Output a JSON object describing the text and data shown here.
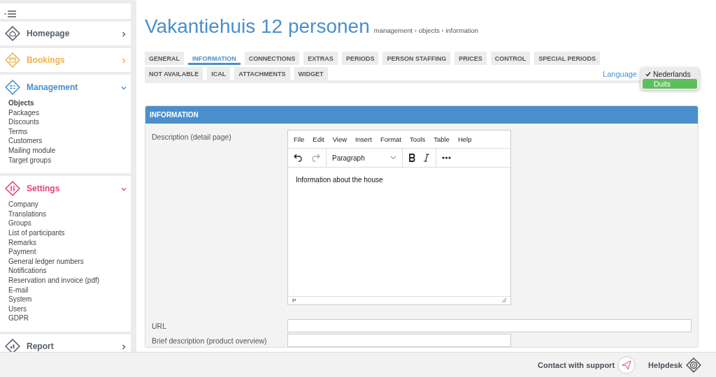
{
  "sidebar": {
    "sections": [
      {
        "kind": "home",
        "title": "Homepage",
        "color": "#555e6b",
        "expanded": false
      },
      {
        "kind": "bookings",
        "title": "Bookings",
        "color": "#f0b24a",
        "expanded": false
      },
      {
        "kind": "management",
        "title": "Management",
        "color": "#4a8fcb",
        "expanded": true,
        "items": [
          {
            "label": "Objects",
            "selected": true
          },
          {
            "label": "Packages",
            "selected": false
          },
          {
            "label": "Discounts",
            "selected": false
          },
          {
            "label": "Terms",
            "selected": false
          },
          {
            "label": "Customers",
            "selected": false
          },
          {
            "label": "Mailing module",
            "selected": false
          },
          {
            "label": "Target groups",
            "selected": false
          }
        ]
      },
      {
        "kind": "settings",
        "title": "Settings",
        "color": "#e0457b",
        "expanded": true,
        "items": [
          {
            "label": "Company",
            "selected": false
          },
          {
            "label": "Translations",
            "selected": false
          },
          {
            "label": "Groups",
            "selected": false
          },
          {
            "label": "List of participants",
            "selected": false
          },
          {
            "label": "Remarks",
            "selected": false
          },
          {
            "label": "Payment",
            "selected": false
          },
          {
            "label": "General ledger numbers",
            "selected": false
          },
          {
            "label": "Notifications",
            "selected": false
          },
          {
            "label": "Reservation and invoice (pdf)",
            "selected": false
          },
          {
            "label": "E-mail",
            "selected": false
          },
          {
            "label": "System",
            "selected": false
          },
          {
            "label": "Users",
            "selected": false
          },
          {
            "label": "GDPR",
            "selected": false
          }
        ]
      },
      {
        "kind": "report",
        "title": "Report",
        "color": "#555e6b",
        "expanded": false
      }
    ]
  },
  "page": {
    "title": "Vakantiehuis 12 personen",
    "breadcrumb": "management › objects › information"
  },
  "tab_rows": [
    [
      {
        "label": "GENERAL",
        "selected": false
      },
      {
        "label": "INFORMATION",
        "selected": true
      },
      {
        "label": "CONNECTIONS",
        "selected": false
      },
      {
        "label": "EXTRAS",
        "selected": false
      },
      {
        "label": "PERIODS",
        "selected": false
      },
      {
        "label": "PERSON STAFFING",
        "selected": false
      },
      {
        "label": "PRICES",
        "selected": false
      },
      {
        "label": "CONTROL",
        "selected": false
      },
      {
        "label": "SPECIAL PERIODS",
        "selected": false
      }
    ],
    [
      {
        "label": "NOT AVAILABLE",
        "selected": false
      },
      {
        "label": "ICAL",
        "selected": false
      },
      {
        "label": "ATTACHMENTS",
        "selected": false
      },
      {
        "label": "WIDGET",
        "selected": false
      }
    ]
  ],
  "language": {
    "label": "Language",
    "options": [
      {
        "label": "Nederlands",
        "selected": true,
        "highlighted": false
      },
      {
        "label": "Duits",
        "selected": false,
        "highlighted": true
      }
    ]
  },
  "panel": {
    "title": "INFORMATION",
    "editor": {
      "label": "Description (detail page)",
      "menu": [
        "File",
        "Edit",
        "View",
        "Insert",
        "Format",
        "Tools",
        "Table",
        "Help"
      ],
      "block_format": "Paragraph",
      "content": "Information about the house",
      "status": "P"
    },
    "fields": [
      {
        "label": "URL",
        "kind": "wide"
      },
      {
        "label": "Brief description (product overview)",
        "kind": "narrow"
      }
    ]
  },
  "footer": {
    "support": "Contact with support",
    "helpdesk": "Helpdesk"
  }
}
